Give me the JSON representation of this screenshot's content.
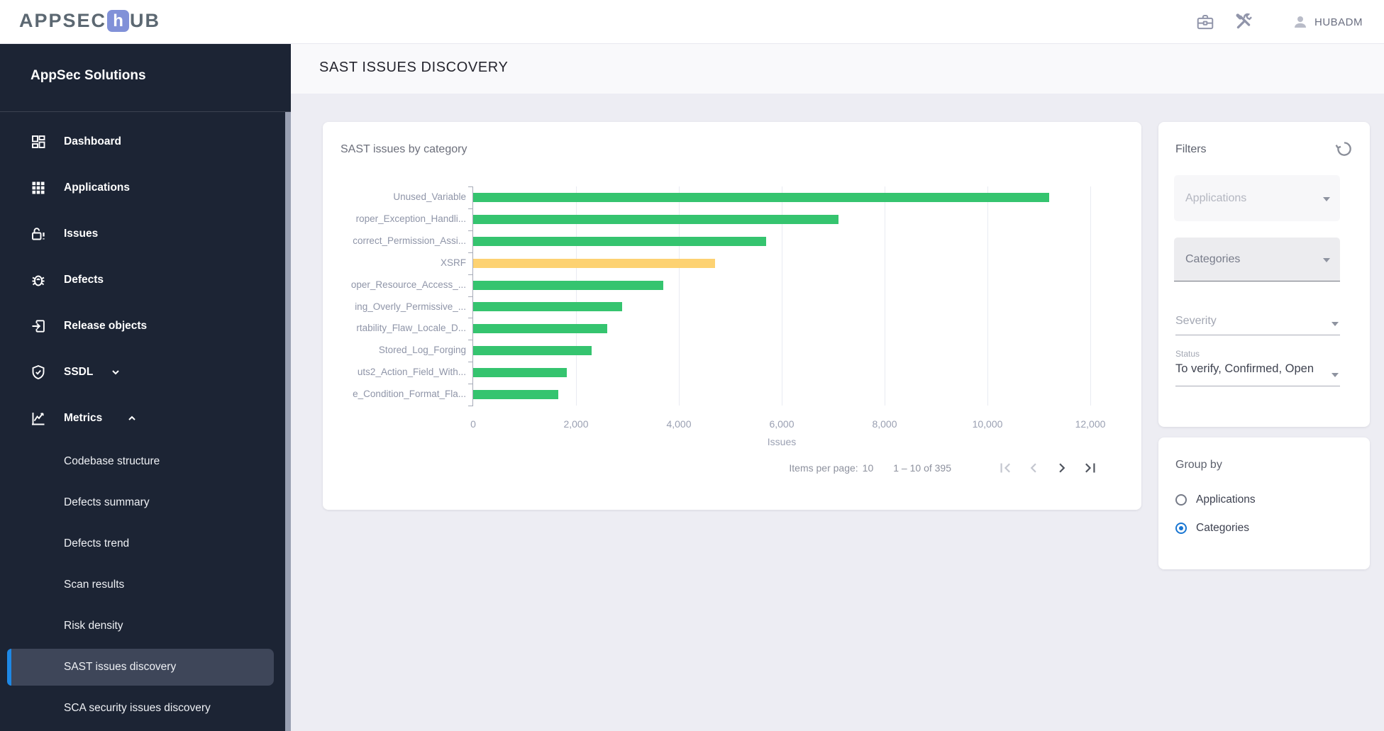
{
  "app_header": {
    "logo": {
      "part1": "APPSEC",
      "accent": "h",
      "part2": "UB"
    },
    "user": "HUBADM"
  },
  "sidebar": {
    "title": "AppSec Solutions",
    "items": [
      {
        "label": "Dashboard",
        "icon": "dashboard-icon"
      },
      {
        "label": "Applications",
        "icon": "applications-icon"
      },
      {
        "label": "Issues",
        "icon": "issues-icon"
      },
      {
        "label": "Defects",
        "icon": "defects-icon"
      },
      {
        "label": "Release objects",
        "icon": "release-objects-icon"
      },
      {
        "label": "SSDL",
        "icon": "ssdl-icon",
        "state": "collapsed"
      },
      {
        "label": "Metrics",
        "icon": "metrics-icon",
        "state": "expanded"
      }
    ],
    "metrics_children": [
      {
        "label": "Codebase structure",
        "selected": false
      },
      {
        "label": "Defects summary",
        "selected": false
      },
      {
        "label": "Defects trend",
        "selected": false
      },
      {
        "label": "Scan results",
        "selected": false
      },
      {
        "label": "Risk density",
        "selected": false
      },
      {
        "label": "SAST issues discovery",
        "selected": true
      },
      {
        "label": "SCA security issues discovery",
        "selected": false
      }
    ]
  },
  "page": {
    "title": "SAST ISSUES DISCOVERY"
  },
  "chart_card": {
    "title": "SAST issues by category",
    "pagination": {
      "items_per_page_label": "Items per page:",
      "items_per_page_value": "10",
      "range_label": "1 – 10 of 395"
    }
  },
  "chart_data": {
    "type": "bar",
    "orientation": "horizontal",
    "title": "SAST issues by category",
    "categories": [
      "Unused_Variable",
      "roper_Exception_Handli...",
      "correct_Permission_Assi...",
      "XSRF",
      "oper_Resource_Access_...",
      "ing_Overly_Permissive_...",
      "rtability_Flaw_Locale_D...",
      "Stored_Log_Forging",
      "uts2_Action_Field_With...",
      "e_Condition_Format_Fla..."
    ],
    "values": [
      11200,
      7100,
      5700,
      4700,
      3700,
      2900,
      2600,
      2300,
      1820,
      1660
    ],
    "bar_colors": [
      "#35c46f",
      "#35c46f",
      "#35c46f",
      "#fdd272",
      "#35c46f",
      "#35c46f",
      "#35c46f",
      "#35c46f",
      "#35c46f",
      "#35c46f"
    ],
    "xlabel": "Issues",
    "ylabel": "",
    "xlim": [
      0,
      12000
    ],
    "x_ticks": [
      0,
      2000,
      4000,
      6000,
      8000,
      10000,
      12000
    ],
    "x_tick_labels": [
      "0",
      "2,000",
      "4,000",
      "6,000",
      "8,000",
      "10,000",
      "12,000"
    ],
    "grid": "vertical-gridlines",
    "legend": "none"
  },
  "filters": {
    "title": "Filters",
    "applications_placeholder": "Applications",
    "categories_placeholder": "Categories",
    "severity_placeholder": "Severity",
    "status_label": "Status",
    "status_value": "To verify, Confirmed, Open"
  },
  "group_by": {
    "title": "Group by",
    "options": [
      {
        "label": "Applications",
        "checked": false
      },
      {
        "label": "Categories",
        "checked": true
      }
    ]
  },
  "colors": {
    "sidebar_bg": "#1c2434",
    "selected_item_bg": "#3e4659",
    "accent_blue": "#1e88e5",
    "bar_green": "#35c46f",
    "bar_yellow": "#fdd272",
    "main_bg": "#ededf3"
  }
}
